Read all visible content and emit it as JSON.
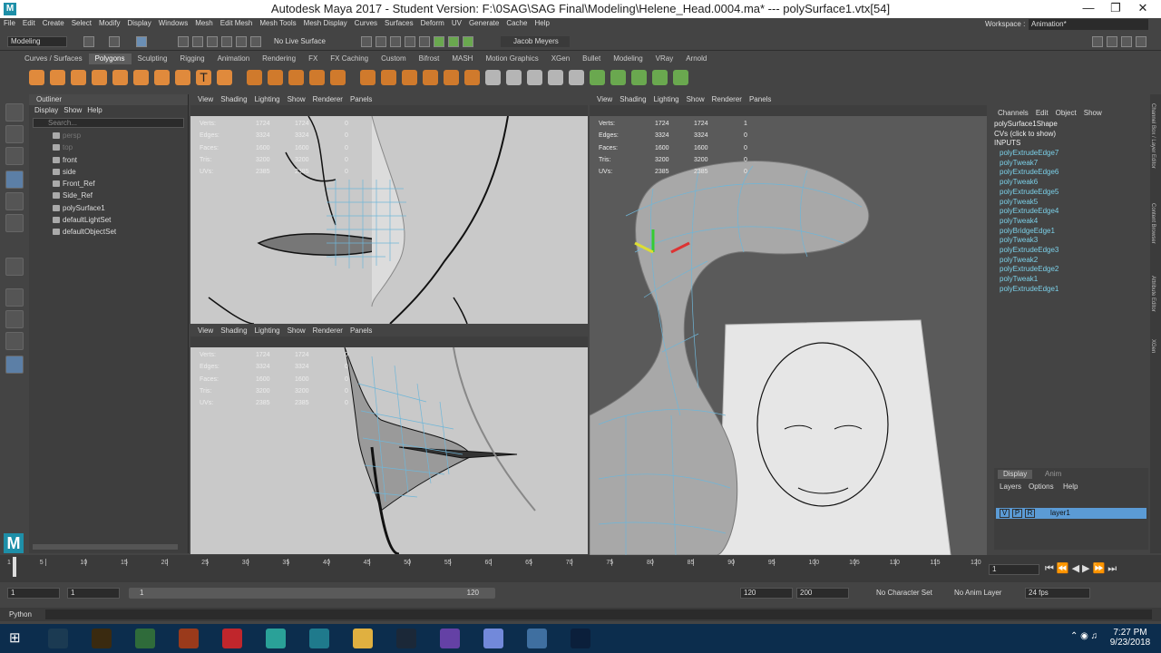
{
  "window": {
    "title": "Autodesk Maya 2017 - Student Version: F:\\0SAG\\SAG Final\\Modeling\\Helene_Head.0004.ma*  ---  polySurface1.vtx[54]",
    "app_icon": "M",
    "controls": [
      "—",
      "❐",
      "✕"
    ]
  },
  "menubar": {
    "items": [
      "File",
      "Edit",
      "Create",
      "Select",
      "Modify",
      "Display",
      "Windows",
      "Mesh",
      "Edit Mesh",
      "Mesh Tools",
      "Mesh Display",
      "Curves",
      "Surfaces",
      "Deform",
      "UV",
      "Generate",
      "Cache",
      "Help"
    ],
    "workspace_label": "Workspace :",
    "workspace_value": "Animation*"
  },
  "statusline": {
    "mode": "Modeling",
    "live_surface": "No Live Surface",
    "user": "Jacob Meyers"
  },
  "shelf": {
    "tabs": [
      "Curves / Surfaces",
      "Polygons",
      "Sculpting",
      "Rigging",
      "Animation",
      "Rendering",
      "FX",
      "FX Caching",
      "Custom",
      "Bifrost",
      "MASH",
      "Motion Graphics",
      "XGen",
      "Bullet",
      "Modeling",
      "VRay",
      "Arnold"
    ],
    "active": "Polygons"
  },
  "outliner": {
    "title": "Outliner",
    "menu": [
      "Display",
      "Show",
      "Help"
    ],
    "search_placeholder": "Search...",
    "items": [
      {
        "label": "persp",
        "dim": true
      },
      {
        "label": "top",
        "dim": true
      },
      {
        "label": "front",
        "dim": false
      },
      {
        "label": "side",
        "dim": false
      },
      {
        "label": "Front_Ref",
        "dim": false
      },
      {
        "label": "Side_Ref",
        "dim": false
      },
      {
        "label": "polySurface1",
        "dim": false
      },
      {
        "label": "defaultLightSet",
        "dim": false
      },
      {
        "label": "defaultObjectSet",
        "dim": false
      }
    ]
  },
  "viewport_menu": [
    "View",
    "Shading",
    "Lighting",
    "Show",
    "Renderer",
    "Panels"
  ],
  "hud": {
    "labels": [
      "Verts:",
      "Edges:",
      "Faces:",
      "Tris:",
      "UVs:"
    ],
    "col1": [
      "1724",
      "3324",
      "1600",
      "3200",
      "2385"
    ],
    "col2": [
      "1724",
      "3324",
      "1600",
      "3200",
      "2385"
    ],
    "col3": [
      "0",
      "0",
      "0",
      "0",
      "0"
    ],
    "right_col3": [
      "1",
      "0",
      "0",
      "0",
      "0"
    ]
  },
  "channel_box": {
    "menu": [
      "Channels",
      "Edit",
      "Object",
      "Show"
    ],
    "shape": "polySurface1Shape",
    "cvs": "CVs (click to show)",
    "inputs_label": "INPUTS",
    "inputs": [
      "polyExtrudeEdge7",
      "polyTweak7",
      "polyExtrudeEdge6",
      "polyTweak6",
      "polyExtrudeEdge5",
      "polyTweak5",
      "polyExtrudeEdge4",
      "polyTweak4",
      "polyBridgeEdge1",
      "polyTweak3",
      "polyExtrudeEdge3",
      "polyTweak2",
      "polyExtrudeEdge2",
      "polyTweak1",
      "polyExtrudeEdge1"
    ],
    "side_tabs": [
      "Channel Box / Layer Editor",
      "Content Browser",
      "Attribute Editor",
      "XGen"
    ]
  },
  "layers": {
    "tabs": [
      "Display",
      "Anim"
    ],
    "menu": [
      "Layers",
      "Options",
      "Help"
    ],
    "layer": {
      "v": "V",
      "p": "P",
      "r": "R",
      "name": "layer1"
    }
  },
  "timeline": {
    "ticks": [
      "1",
      "5",
      "10",
      "15",
      "20",
      "25",
      "30",
      "35",
      "40",
      "45",
      "50",
      "55",
      "60",
      "65",
      "70",
      "75",
      "80",
      "85",
      "90",
      "95",
      "100",
      "105",
      "110",
      "115",
      "120"
    ],
    "current": "1"
  },
  "range": {
    "start": "1",
    "start2": "1",
    "slider_start": "1",
    "slider_end": "120",
    "end": "120",
    "end2": "200",
    "char_set": "No Character Set",
    "anim_layer": "No Anim Layer",
    "fps": "24 fps"
  },
  "cmdline": {
    "label": "Python"
  },
  "taskbar": {
    "time": "7:27 PM",
    "date": "9/23/2018",
    "apps": [
      {
        "name": "league-icon",
        "color": "#1b3a52"
      },
      {
        "name": "wow-icon",
        "color": "#3a2a10"
      },
      {
        "name": "chrome-icon",
        "color": "#2f6b3a"
      },
      {
        "name": "firefox-icon",
        "color": "#9a3a1b"
      },
      {
        "name": "adobe-cc-icon",
        "color": "#c0262c"
      },
      {
        "name": "maya-icon",
        "color": "#2aa198"
      },
      {
        "name": "3dsmax-icon",
        "color": "#1f7a8c"
      },
      {
        "name": "explorer-icon",
        "color": "#e0b040"
      },
      {
        "name": "steam-icon",
        "color": "#1b2838"
      },
      {
        "name": "twitch-icon",
        "color": "#6441a5"
      },
      {
        "name": "discord-icon",
        "color": "#7289da"
      },
      {
        "name": "photos-icon",
        "color": "#3f6fa0"
      },
      {
        "name": "photoshop-icon",
        "color": "#0b1f3b"
      }
    ]
  }
}
